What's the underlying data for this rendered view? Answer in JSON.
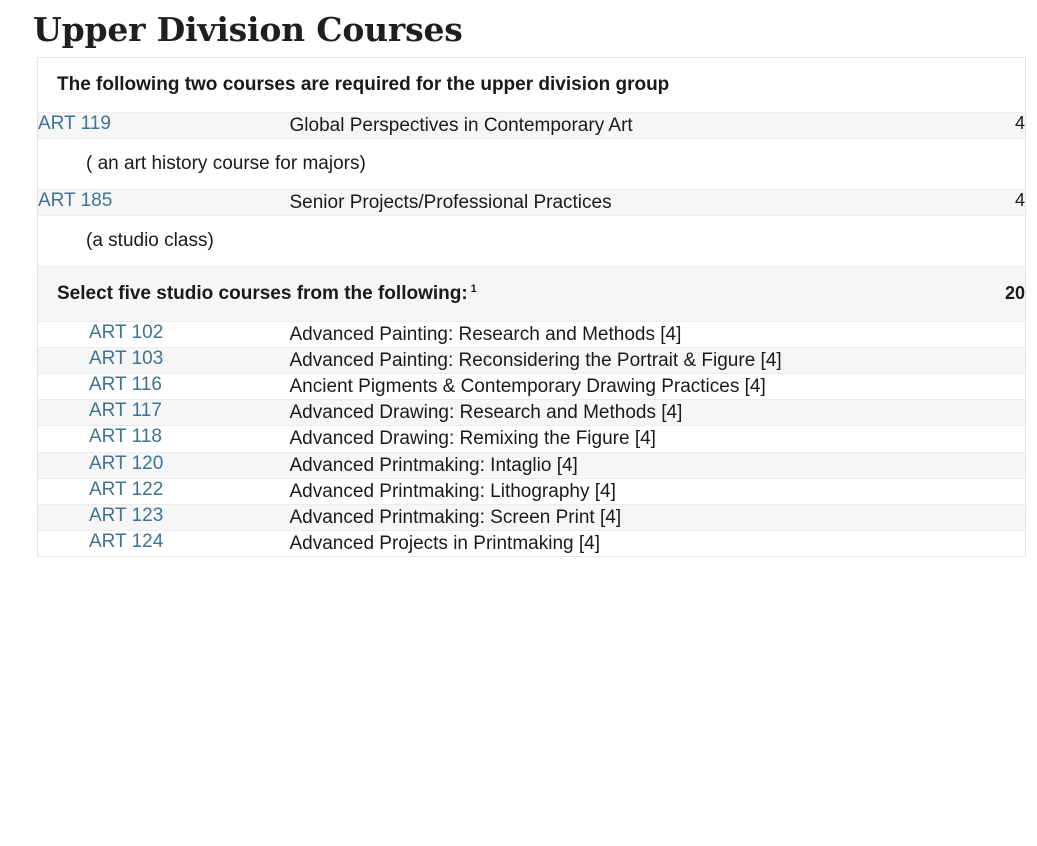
{
  "page": {
    "title": "Upper Division Courses"
  },
  "table": {
    "rows": [
      {
        "kind": "areaheader",
        "text": "The following two courses are required for the upper division group"
      },
      {
        "kind": "course",
        "shade": "odd",
        "indent": false,
        "code": "ART 119",
        "title": "Global Perspectives in Contemporary Art",
        "hours": "4"
      },
      {
        "kind": "comment",
        "text": "( an art history course for majors)"
      },
      {
        "kind": "course",
        "shade": "odd",
        "indent": false,
        "code": "ART 185",
        "title": "Senior Projects/Professional Practices",
        "hours": "4"
      },
      {
        "kind": "comment",
        "text": "(a studio class)"
      },
      {
        "kind": "listsum",
        "text": "Select five studio courses from the following:",
        "footnote": "1",
        "hours": "20"
      },
      {
        "kind": "course",
        "shade": "even",
        "indent": true,
        "code": "ART 102",
        "title": "Advanced Painting: Research and Methods [4]",
        "hours": ""
      },
      {
        "kind": "course",
        "shade": "odd",
        "indent": true,
        "code": "ART 103",
        "title": "Advanced Painting: Reconsidering the Portrait & Figure [4]",
        "hours": ""
      },
      {
        "kind": "course",
        "shade": "even",
        "indent": true,
        "code": "ART 116",
        "title": "Ancient Pigments & Contemporary Drawing Practices [4]",
        "hours": ""
      },
      {
        "kind": "course",
        "shade": "odd",
        "indent": true,
        "code": "ART 117",
        "title": "Advanced Drawing: Research and Methods [4]",
        "hours": ""
      },
      {
        "kind": "course",
        "shade": "even",
        "indent": true,
        "code": "ART 118",
        "title": "Advanced Drawing: Remixing the Figure [4]",
        "hours": ""
      },
      {
        "kind": "course",
        "shade": "odd",
        "indent": true,
        "code": "ART 120",
        "title": "Advanced Printmaking: Intaglio [4]",
        "hours": ""
      },
      {
        "kind": "course",
        "shade": "even",
        "indent": true,
        "code": "ART 122",
        "title": "Advanced Printmaking: Lithography [4]",
        "hours": ""
      },
      {
        "kind": "course",
        "shade": "odd",
        "indent": true,
        "code": "ART 123",
        "title": "Advanced Printmaking: Screen Print [4]",
        "hours": ""
      },
      {
        "kind": "course",
        "shade": "even",
        "indent": true,
        "code": "ART 124",
        "title": "Advanced Projects in Printmaking [4]",
        "hours": ""
      }
    ]
  },
  "colors": {
    "link": "#3f7393",
    "row_shade": "#f6f6f6",
    "border": "#ececec",
    "text": "#1a1a1a"
  }
}
